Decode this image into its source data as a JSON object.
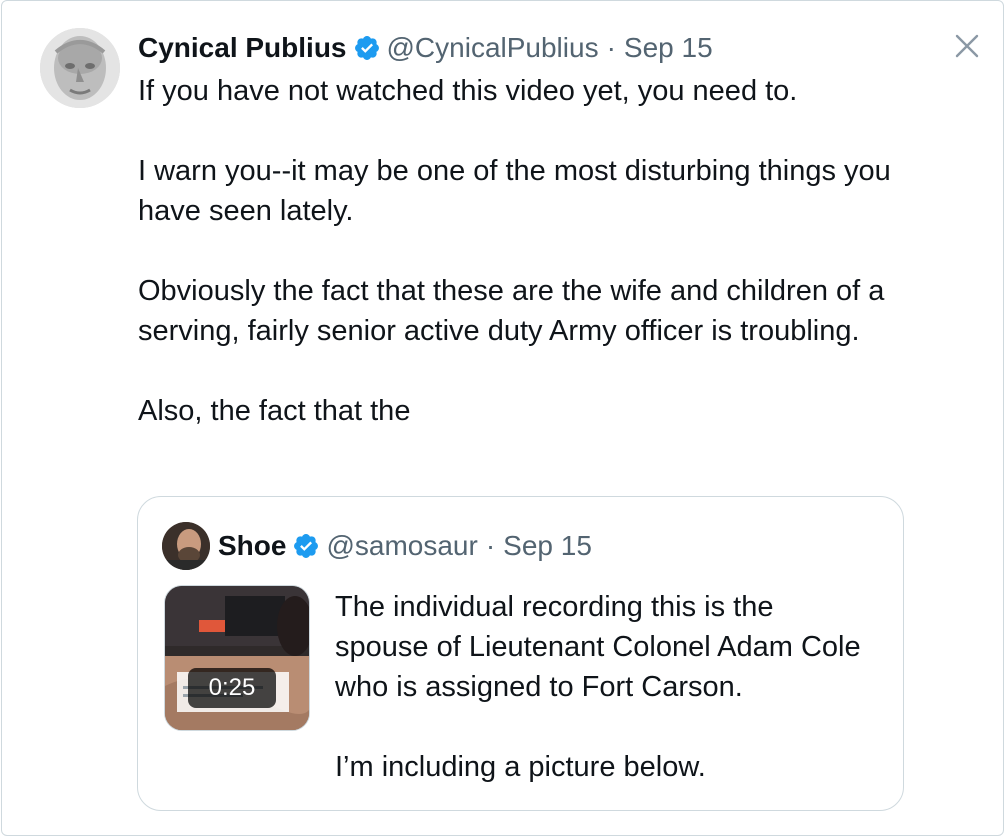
{
  "tweet": {
    "display_name": "Cynical Publius",
    "handle": "@CynicalPublius",
    "separator": "·",
    "date": "Sep 15",
    "paragraphs": [
      "If you have not watched this video yet, you need to.",
      "I warn you--it may be one of the most disturbing things you have seen lately.",
      "Obviously the fact that these are the wife and children of a serving, fairly senior active duty Army officer is troubling.",
      "Also, the fact that the"
    ]
  },
  "quoted_tweet": {
    "display_name": "Shoe",
    "handle": "@samosaur",
    "separator": "·",
    "date": "Sep 15",
    "video_duration": "0:25",
    "paragraphs": [
      "The individual recording this is the spouse of Lieutenant Colonel Adam Cole who is assigned to Fort Carson.",
      "I’m including a picture below."
    ]
  },
  "icons": {
    "close": "close-icon",
    "verified": "verified-badge-icon"
  },
  "colors": {
    "text": "#0f1419",
    "secondary": "#536471",
    "verified": "#1d9bf0",
    "border": "#cfd9de"
  }
}
